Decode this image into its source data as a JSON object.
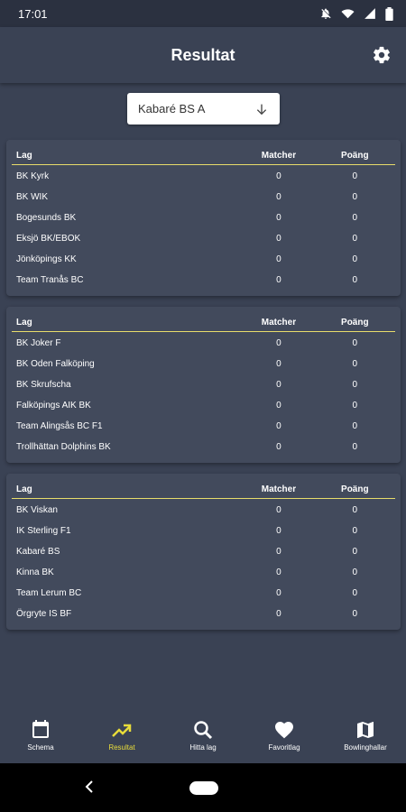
{
  "status_bar": {
    "time": "17:01"
  },
  "app_bar": {
    "title": "Resultat"
  },
  "dropdown": {
    "selected": "Kabaré BS A"
  },
  "table_headers": {
    "team": "Lag",
    "matches": "Matcher",
    "points": "Poäng"
  },
  "groups": [
    {
      "rows": [
        {
          "team": "BK Kyrk",
          "matches": "0",
          "points": "0"
        },
        {
          "team": "BK WIK",
          "matches": "0",
          "points": "0"
        },
        {
          "team": "Bogesunds BK",
          "matches": "0",
          "points": "0"
        },
        {
          "team": "Eksjö BK/EBOK",
          "matches": "0",
          "points": "0"
        },
        {
          "team": "Jönköpings KK",
          "matches": "0",
          "points": "0"
        },
        {
          "team": "Team Tranås BC",
          "matches": "0",
          "points": "0"
        }
      ]
    },
    {
      "rows": [
        {
          "team": "BK Joker F",
          "matches": "0",
          "points": "0"
        },
        {
          "team": "BK Oden Falköping",
          "matches": "0",
          "points": "0"
        },
        {
          "team": "BK Skrufscha",
          "matches": "0",
          "points": "0"
        },
        {
          "team": "Falköpings AIK BK",
          "matches": "0",
          "points": "0"
        },
        {
          "team": "Team Alingsås BC F1",
          "matches": "0",
          "points": "0"
        },
        {
          "team": "Trollhättan Dolphins BK",
          "matches": "0",
          "points": "0"
        }
      ]
    },
    {
      "rows": [
        {
          "team": "BK Viskan",
          "matches": "0",
          "points": "0"
        },
        {
          "team": "IK Sterling F1",
          "matches": "0",
          "points": "0"
        },
        {
          "team": "Kabaré BS",
          "matches": "0",
          "points": "0"
        },
        {
          "team": "Kinna BK",
          "matches": "0",
          "points": "0"
        },
        {
          "team": "Team Lerum BC",
          "matches": "0",
          "points": "0"
        },
        {
          "team": "Örgryte IS BF",
          "matches": "0",
          "points": "0"
        }
      ]
    }
  ],
  "bottom_nav": [
    {
      "label": "Schema",
      "icon": "calendar-icon",
      "active": false
    },
    {
      "label": "Resultat",
      "icon": "trending-icon",
      "active": true
    },
    {
      "label": "Hitta lag",
      "icon": "search-icon",
      "active": false
    },
    {
      "label": "Favoritlag",
      "icon": "heart-icon",
      "active": false
    },
    {
      "label": "Bowlinghallar",
      "icon": "map-icon",
      "active": false
    }
  ],
  "colors": {
    "background": "#3a4254",
    "card": "#424a5c",
    "accent": "#e8dc3a"
  }
}
